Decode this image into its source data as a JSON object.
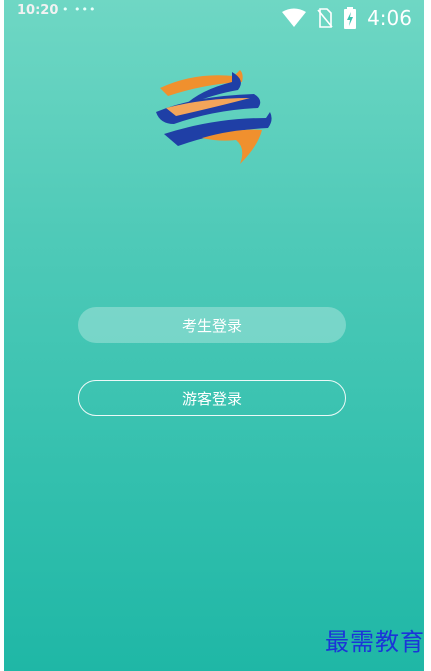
{
  "statusbar": {
    "left_time": "10:20",
    "dots": "• •••",
    "clock": "4:06",
    "icons": [
      "wifi-icon",
      "no-sim-icon",
      "battery-charging-icon",
      "notification-cluster-icon"
    ]
  },
  "logo": {
    "name": "app-logo",
    "colors": {
      "blue": "#1f3fa6",
      "orange": "#f0902e"
    }
  },
  "login": {
    "student_label": "考生登录",
    "guest_label": "游客登录"
  },
  "watermark": {
    "text": "最需教育",
    "color": "#1b34d8"
  }
}
